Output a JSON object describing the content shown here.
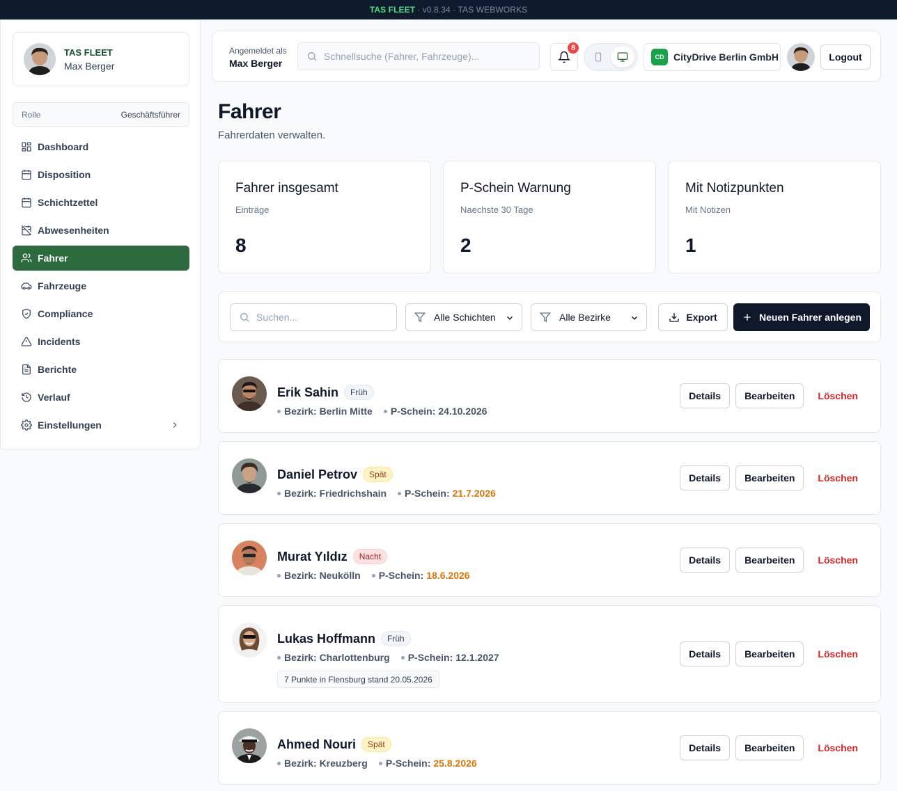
{
  "topbar": {
    "brand": "TAS FLEET",
    "rest": "· v0.8.34 · TAS WEBWORKS"
  },
  "sidebar": {
    "profile": {
      "app": "TAS FLEET",
      "user": "Max Berger"
    },
    "role": {
      "label": "Rolle",
      "value": "Geschäftsführer"
    },
    "items": [
      {
        "label": "Dashboard",
        "icon": "layout-grid-icon"
      },
      {
        "label": "Disposition",
        "icon": "calendar-icon"
      },
      {
        "label": "Schichtzettel",
        "icon": "calendar-icon"
      },
      {
        "label": "Abwesenheiten",
        "icon": "calendar-off-icon"
      },
      {
        "label": "Fahrer",
        "icon": "users-icon",
        "active": true
      },
      {
        "label": "Fahrzeuge",
        "icon": "car-icon"
      },
      {
        "label": "Compliance",
        "icon": "shield-check-icon"
      },
      {
        "label": "Incidents",
        "icon": "alert-triangle-icon"
      },
      {
        "label": "Berichte",
        "icon": "file-text-icon"
      },
      {
        "label": "Verlauf",
        "icon": "history-icon"
      },
      {
        "label": "Einstellungen",
        "icon": "settings-icon"
      }
    ]
  },
  "header": {
    "logged_label": "Angemeldet als",
    "logged_user": "Max Berger",
    "search_placeholder": "Schnellsuche (Fahrer, Fahrzeuge)...",
    "notifications": "8",
    "company_logo": "CD",
    "company": "CityDrive Berlin GmbH",
    "logout": "Logout"
  },
  "page": {
    "title": "Fahrer",
    "subtitle": "Fahrerdaten verwalten."
  },
  "stats": [
    {
      "title": "Fahrer insgesamt",
      "sub": "Einträge",
      "value": "8"
    },
    {
      "title": "P-Schein Warnung",
      "sub": "Naechste 30 Tage",
      "value": "2"
    },
    {
      "title": "Mit Notizpunkten",
      "sub": "Mit Notizen",
      "value": "1"
    }
  ],
  "filters": {
    "search_placeholder": "Suchen...",
    "shift_select": "Alle Schichten",
    "district_select": "Alle Bezirke",
    "export": "Export",
    "new_driver": "Neuen Fahrer anlegen"
  },
  "actions": {
    "details": "Details",
    "edit": "Bearbeiten",
    "delete": "Löschen"
  },
  "drivers": [
    {
      "name": "Erik Sahin",
      "shift": "Früh",
      "district": "Bezirk: Berlin Mitte",
      "pschein_label": "P-Schein:",
      "pschein": "24.10.2026",
      "warning": false,
      "note": ""
    },
    {
      "name": "Daniel Petrov",
      "shift": "Spät",
      "district": "Bezirk: Friedrichshain",
      "pschein_label": "P-Schein:",
      "pschein": "21.7.2026",
      "warning": true,
      "note": ""
    },
    {
      "name": "Murat Yıldız",
      "shift": "Nacht",
      "district": "Bezirk: Neukölln",
      "pschein_label": "P-Schein:",
      "pschein": "18.6.2026",
      "warning": true,
      "note": ""
    },
    {
      "name": "Lukas Hoffmann",
      "shift": "Früh",
      "district": "Bezirk: Charlottenburg",
      "pschein_label": "P-Schein:",
      "pschein": "12.1.2027",
      "warning": false,
      "note": "7 Punkte in Flensburg stand 20.05.2026"
    },
    {
      "name": "Ahmed Nouri",
      "shift": "Spät",
      "district": "Bezirk: Kreuzberg",
      "pschein_label": "P-Schein:",
      "pschein": "25.8.2026",
      "warning": true,
      "note": ""
    }
  ],
  "colors": {
    "accent": "#2d6a3e",
    "primary_button": "#0f172a",
    "danger": "#dc2626",
    "warning": "#d97706"
  }
}
